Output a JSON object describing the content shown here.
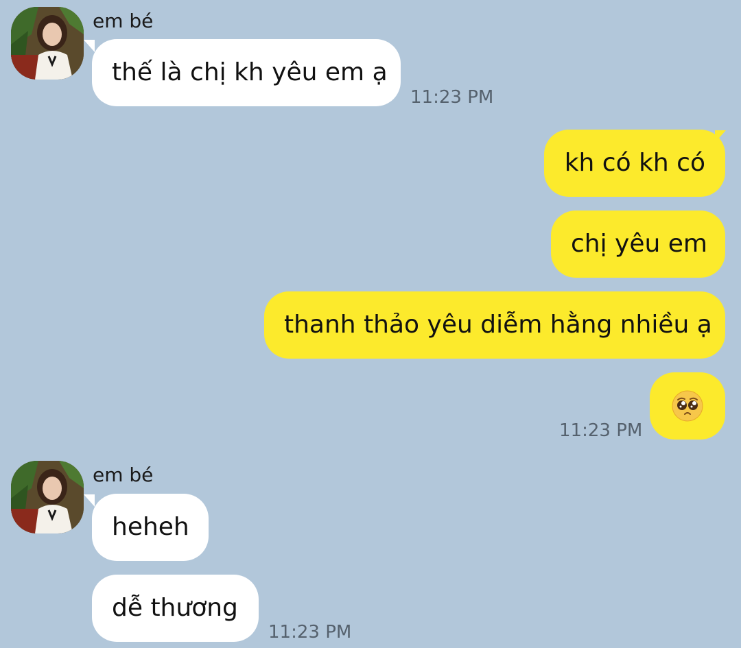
{
  "contact": {
    "name": "em bé"
  },
  "groups": [
    {
      "sender": "em bé",
      "messages": [
        {
          "text": "thế là chị kh yêu em ạ"
        }
      ],
      "time": "11:23 PM"
    },
    {
      "sender": "me",
      "messages": [
        {
          "text": "kh có kh có"
        },
        {
          "text": "chị yêu em"
        },
        {
          "text": "thanh thảo yêu diễm hằng nhiều ạ"
        },
        {
          "text": "",
          "emoji": "pleading-face"
        }
      ],
      "time": "11:23 PM"
    },
    {
      "sender": "em bé",
      "messages": [
        {
          "text": "heheh"
        },
        {
          "text": "dễ thương"
        }
      ],
      "time": "11:23 PM"
    }
  ],
  "colors": {
    "background": "#b2c7da",
    "incoming_bubble": "#ffffff",
    "outgoing_bubble": "#fcea2c",
    "timestamp": "#55616d"
  }
}
